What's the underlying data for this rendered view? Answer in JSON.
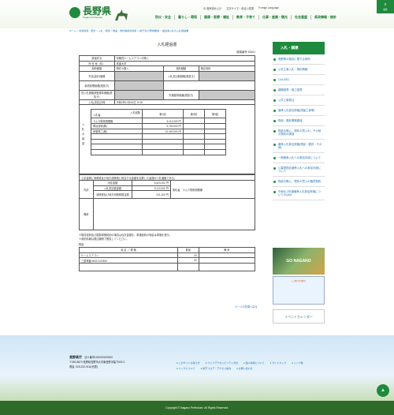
{
  "header": {
    "logo_main": "長野県",
    "logo_sub": "Nagano Prefecture",
    "util": [
      "ID 音声読み上げ",
      "文字サイズ・色合い変更",
      "Foreign Language"
    ],
    "search": "検索"
  },
  "gnav": [
    "防災・安全",
    "暮らし・環境",
    "健康・医療・福祉",
    "教育・子育て",
    "仕事・産業・観光",
    "社会基盤",
    "県政情報・統計"
  ],
  "breadcrumb": "ホーム > 県政情報・統計 > 入札・調達 > 物品・委託等調達情報 > [県庁及び現地機関] 一般競争入札の入札経過書",
  "doc": {
    "title": "入札経過書",
    "number": "調達番号 81601",
    "rows": [
      [
        "調達件名",
        "県職員ルームエアコンの購入"
      ],
      [
        "所 在 地（件）",
        "看護大学"
      ],
      [
        "契約種類",
        "物件の購入",
        "契約種類",
        "随意契約"
      ],
      [
        "予定(設計)価格",
        "",
        "入札書比較価格(税抜き)",
        ""
      ],
      [
        "最低制限価格(税抜き)",
        ""
      ],
      [
        "低入札価格調査基準価格(税抜き)",
        "",
        "失格基準価格(税抜き)",
        ""
      ],
      [
        "入札(決定)日時",
        "令和2年10月16日 10:00"
      ]
    ],
    "bid_header": [
      "入札回数",
      "第1回",
      "第2回",
      "第3回"
    ],
    "bid_label": "入札者",
    "side_label": "入札の経過",
    "bids": [
      [
        "ラムラ厨房調理機",
        "5,112,000",
        "円"
      ],
      [
        "関谷技術(株)",
        "5,760,000",
        "円"
      ],
      [
        "伊藤電工(株)",
        "10,400,000",
        "円"
      ]
    ],
    "note": "上記金額に消費税及び地方消費税に相当する金額を加算した金額が入札価格である。",
    "summary": [
      [
        "決定金額",
        "5,623,200",
        "円"
      ],
      [
        "入札書記載金額",
        "5,112,000",
        "円"
      ],
      [
        "消費税及び地方消費税相当額",
        "511,200",
        "円"
      ]
    ],
    "summary_label": "内訳",
    "winner_label": "落札者",
    "winner": "ラムラ厨房調理機",
    "remarks_label": "備考",
    "notes": [
      "※随意契約及び複数単価契約の場合は合計金額を、単価契約の場合は単価を表示。",
      "※契約情報は発注機関で閲覧してください。"
    ],
    "items_caption": "物品",
    "items_header": [
      "品 名 ／ 規 格",
      "数量",
      "備 考"
    ],
    "items": [
      [
        "ルームエアコン",
        "00"
      ],
      [
        "三菱電機 MSZ-DV2520",
        "00"
      ]
    ]
  },
  "back": "ページの先頭へ戻る",
  "sidebar": {
    "title": "入札・調達",
    "items": [
      "長野県の契約に関する条例",
      "公共工事入札・契約情報",
      "CALS/EC",
      "建築基準・施工基準",
      "公共工事発注",
      "競争入札参加資格(測量工事等)",
      "物品・委託業務調達",
      "物品の購入、物件の買入れ、その他の契約の調達",
      "競争入札参加資格(物品・委託・その他)",
      "一般競争入札への参加手続について",
      "公募型指名競争入札への参加手続について",
      "物品の購入、物件の買入の随意契約",
      "令和元-2年度競争入札参加資格についてのQ&A"
    ],
    "banner1": "GO NAGANO",
    "banner2": "しあわせ信州",
    "event": "イベントカレンダー"
  },
  "footer": {
    "org": "長野県庁",
    "corp": "法人番号1000020200000",
    "addr": "〒380-8570 長野県長野市大字南長野字幅下692-2",
    "tel": "電話: 026-232-0111(代表)",
    "links": [
      "このサイトの考え方",
      "ウェブアクセシビリティ方針",
      "個人情報について",
      "サイトマップ",
      "リンク集",
      "リンクについて",
      "県庁フロア・アクセス案内",
      "お問い合わせ"
    ],
    "copyright": "Copyright © Nagano Prefecture. All Rights Reserved."
  }
}
